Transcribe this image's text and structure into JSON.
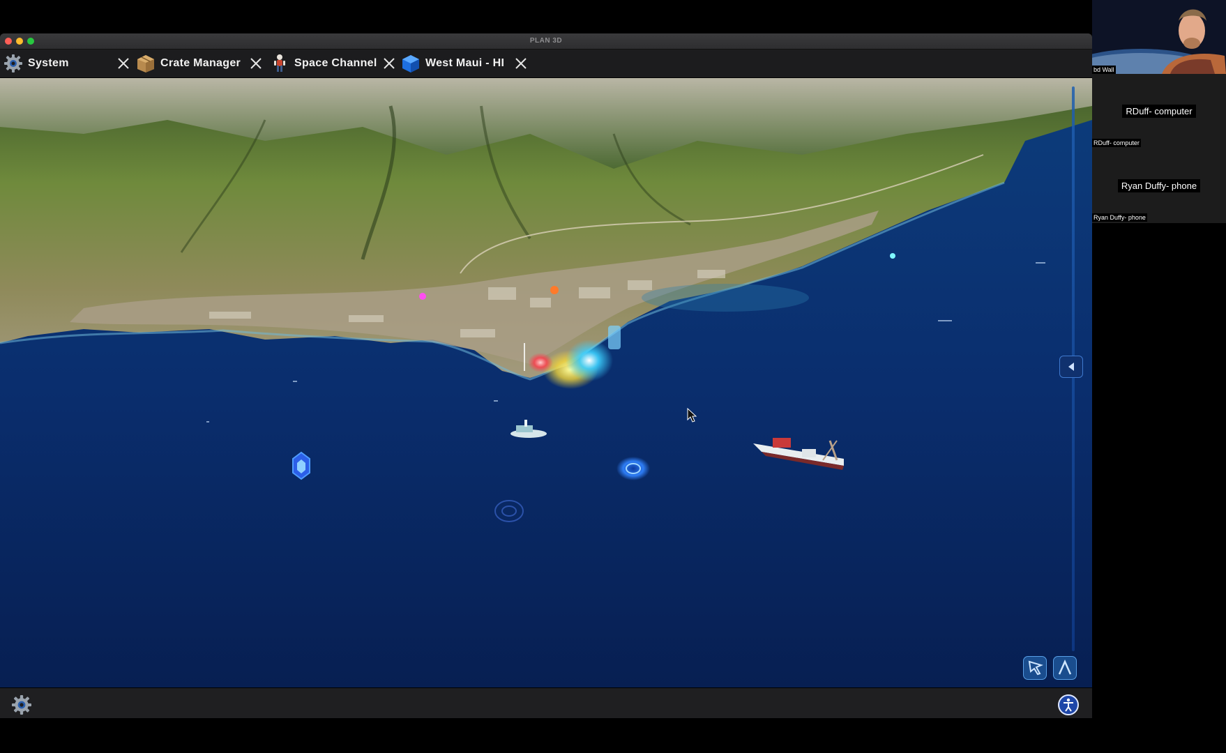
{
  "window": {
    "title": "PLAN 3D"
  },
  "tabs": [
    {
      "label": "System",
      "icon": "gear-icon"
    },
    {
      "label": "Crate Manager",
      "icon": "crate-icon"
    },
    {
      "label": "Space Channel",
      "icon": "astronaut-icon"
    },
    {
      "label": "West Maui - HI",
      "icon": "blue-cube-icon"
    }
  ],
  "viewport": {
    "scene": "3D map of West Maui coastline",
    "toolbar": {
      "select_tool": "cursor-icon",
      "draw_tool": "caret-up-icon"
    },
    "rail_toggle": "chevron-left-icon"
  },
  "bottombar": {
    "settings": "gear-icon",
    "accessibility": "accessibility-icon"
  },
  "video_call": {
    "camera_name": "bd Wall",
    "participants": [
      {
        "title": "RDuff- computer",
        "label": "RDuff- computer"
      },
      {
        "title": "Ryan Duffy- phone",
        "label": "Ryan Duffy- phone"
      }
    ]
  },
  "colors": {
    "ocean": "#0a2a6a",
    "land": "#6f8a3c",
    "accent": "#3a8ef0",
    "tab_bg": "#1c1c1e"
  }
}
